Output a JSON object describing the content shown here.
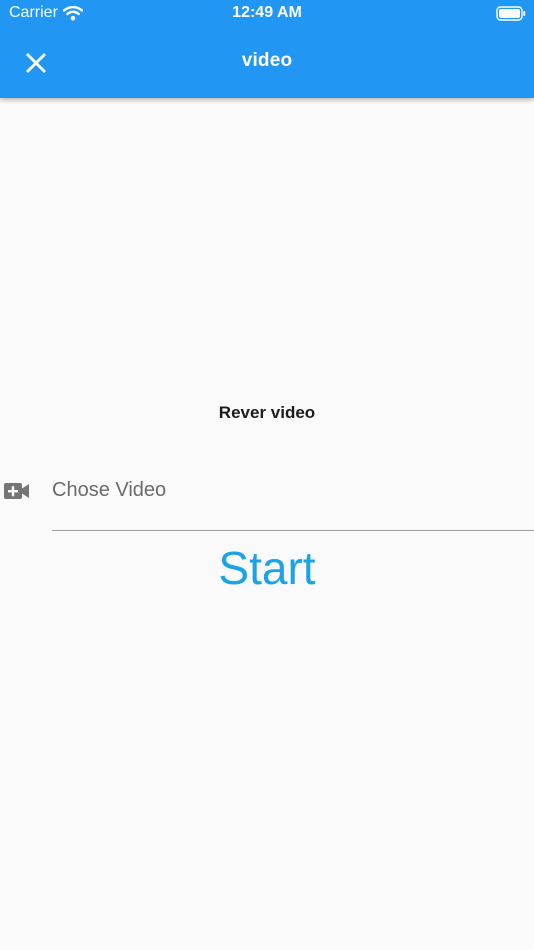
{
  "status_bar": {
    "carrier": "Carrier",
    "time": "12:49 AM",
    "wifi_icon": "wifi-icon",
    "battery_icon": "battery-icon"
  },
  "toolbar": {
    "title": "video",
    "close_icon": "close-icon"
  },
  "main": {
    "section_title": "Rever video",
    "video_field": {
      "icon": "video-add-icon",
      "placeholder": "Chose Video",
      "value": ""
    },
    "start_label": "Start"
  },
  "colors": {
    "app_bar": "#2196f3",
    "background": "#fafafa",
    "accent_text": "#1ba3e8",
    "field_label": "#6b6b6b",
    "divider": "#9e9e9e"
  }
}
